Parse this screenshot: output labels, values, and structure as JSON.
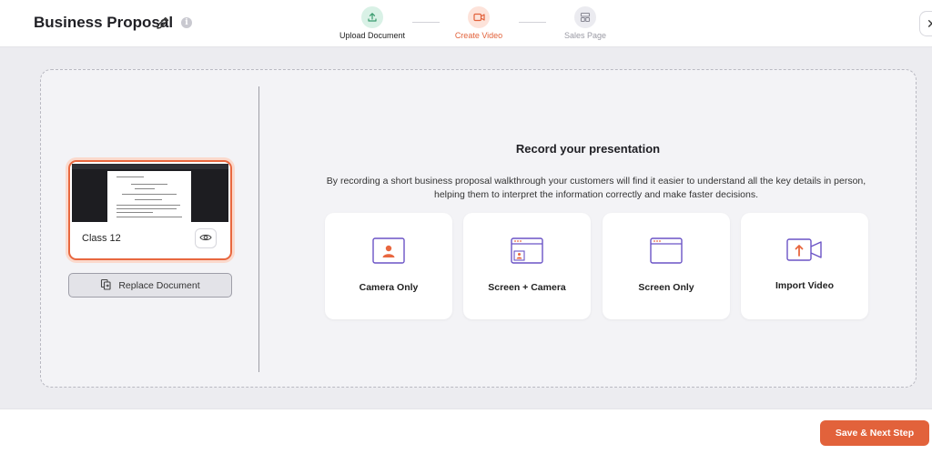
{
  "header": {
    "title": "Business Proposal",
    "steps": [
      {
        "label": "Upload Document",
        "icon": "upload-icon",
        "state": "done"
      },
      {
        "label": "Create Video",
        "icon": "video-camera-icon",
        "state": "active"
      },
      {
        "label": "Sales Page",
        "icon": "layout-icon",
        "state": "pending"
      }
    ],
    "close_icon": "close-icon"
  },
  "document": {
    "name": "Class 12",
    "replace_label": "Replace Document"
  },
  "record": {
    "title": "Record your presentation",
    "description_line1": "By recording a short business proposal walkthrough your customers will find it easier to understand all the key details in person,",
    "description_line2": "helping them to interpret the information correctly and make faster decisions.",
    "options": [
      {
        "label": "Camera Only",
        "icon": "camera-only-icon"
      },
      {
        "label": "Screen + Camera",
        "icon": "screen-camera-icon"
      },
      {
        "label": "Screen Only",
        "icon": "screen-only-icon"
      },
      {
        "label": "Import Video",
        "icon": "import-video-icon"
      }
    ]
  },
  "footer": {
    "save_label": "Save & Next Step"
  },
  "colors": {
    "accent": "#e2623b",
    "step_done_bg": "#d9f1e6",
    "icon_purple": "#6b54c6"
  }
}
